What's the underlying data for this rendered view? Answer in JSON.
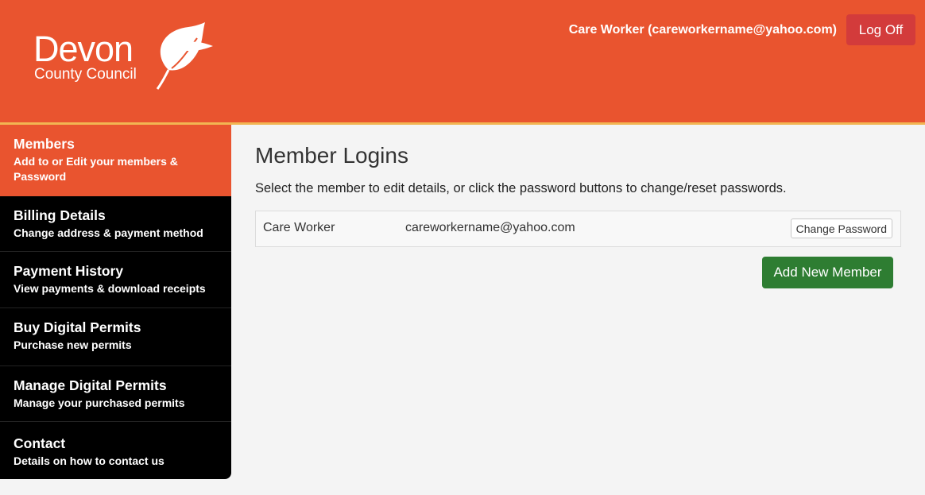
{
  "logo": {
    "line1": "Devon",
    "line2": "County Council",
    "icon": "leaf-icon"
  },
  "header": {
    "user_label": "Care Worker (careworkername@yahoo.com)",
    "logoff_label": "Log Off"
  },
  "colors": {
    "brand_orange": "#e9542f",
    "accent_yellow": "#f2b552",
    "logoff_red": "#d33b3b",
    "add_green": "#2e7d32",
    "sidebar_bg": "#000000"
  },
  "sidebar": {
    "items": [
      {
        "title": "Members",
        "subtitle": "Add to or Edit your members & Password",
        "active": true
      },
      {
        "title": "Billing Details",
        "subtitle": "Change address & payment method"
      },
      {
        "title": "Payment History",
        "subtitle": "View payments & download receipts"
      },
      {
        "title": "Buy Digital Permits",
        "subtitle": "Purchase new permits"
      },
      {
        "title": "Manage Digital Permits",
        "subtitle": "Manage your purchased permits"
      },
      {
        "title": "Contact",
        "subtitle": "Details on how to contact us"
      }
    ]
  },
  "main": {
    "title": "Member Logins",
    "instructions": "Select the member to edit details, or click the password buttons to change/reset passwords.",
    "members": [
      {
        "name": "Care Worker",
        "email": "careworkername@yahoo.com",
        "action_label": "Change Password"
      }
    ],
    "add_button_label": "Add New Member"
  }
}
